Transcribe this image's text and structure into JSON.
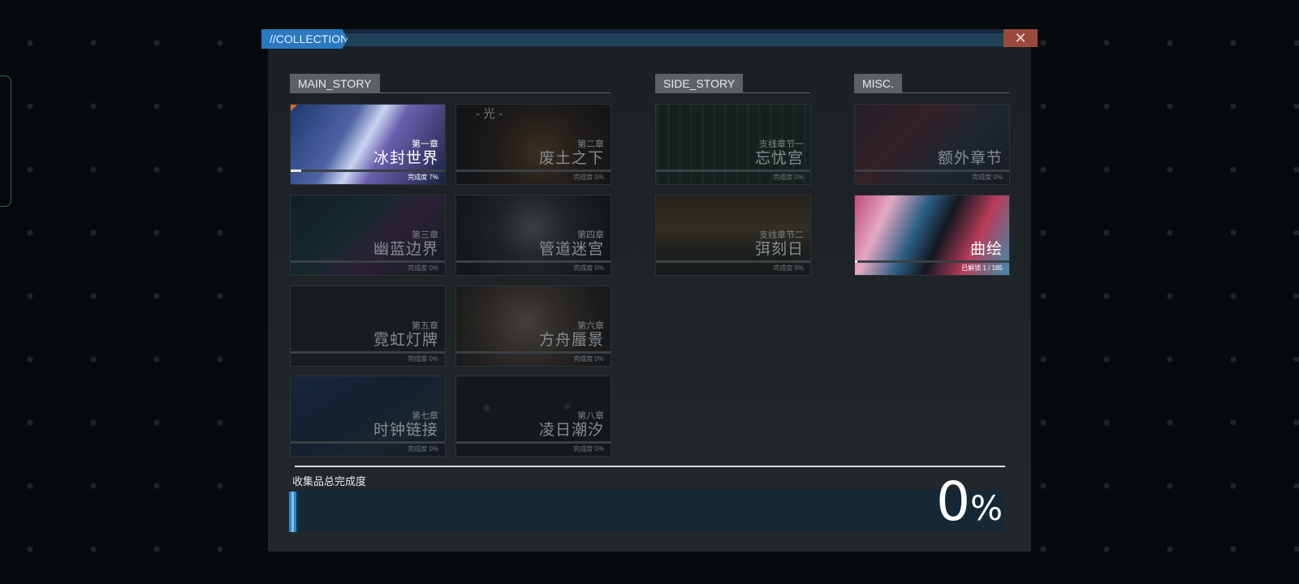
{
  "window": {
    "title": "//COLLECTION",
    "close_icon": "close-icon"
  },
  "sections": {
    "main": {
      "label": "MAIN_STORY"
    },
    "side": {
      "label": "SIDE_STORY"
    },
    "misc": {
      "label": "MISC."
    }
  },
  "main_cards": [
    {
      "chapter": "第一章",
      "name": "冰封世界",
      "progress_text": "完成度 7%",
      "progress": 0.07,
      "active": true
    },
    {
      "chapter": "第二章",
      "name": "废土之下",
      "progress_text": "完成度 0%",
      "progress": 0
    },
    {
      "chapter": "第三章",
      "name": "幽蓝边界",
      "progress_text": "完成度 0%",
      "progress": 0
    },
    {
      "chapter": "第四章",
      "name": "管道迷宫",
      "progress_text": "完成度 0%",
      "progress": 0
    },
    {
      "chapter": "第五章",
      "name": "霓虹灯牌",
      "progress_text": "完成度 0%",
      "progress": 0
    },
    {
      "chapter": "第六章",
      "name": "方舟蜃景",
      "progress_text": "完成度 0%",
      "progress": 0
    },
    {
      "chapter": "第七章",
      "name": "时钟链接",
      "progress_text": "完成度 0%",
      "progress": 0
    },
    {
      "chapter": "第八章",
      "name": "凌日潮汐",
      "progress_text": "完成度 0%",
      "progress": 0
    }
  ],
  "side_cards": [
    {
      "chapter": "支线章节一",
      "name": "忘忧宫",
      "progress_text": "完成度 0%",
      "progress": 0
    },
    {
      "chapter": "支线章节二",
      "name": "弭刻日",
      "progress_text": "完成度 0%",
      "progress": 0
    }
  ],
  "misc_cards": [
    {
      "chapter": "",
      "name": "额外章节",
      "progress_text": "完成度 0%",
      "progress": 0
    },
    {
      "chapter": "",
      "name": "曲绘",
      "progress_text": "已解锁 1 / 185",
      "progress": 0.0054,
      "active": true
    }
  ],
  "card2_top_text": "- 光 -",
  "total": {
    "label": "收集品总完成度",
    "value": "0",
    "unit": "%"
  },
  "colors": {
    "accent": "#2a78c0",
    "close": "#9a4a3c",
    "bar_fill": "#e9ecef"
  }
}
